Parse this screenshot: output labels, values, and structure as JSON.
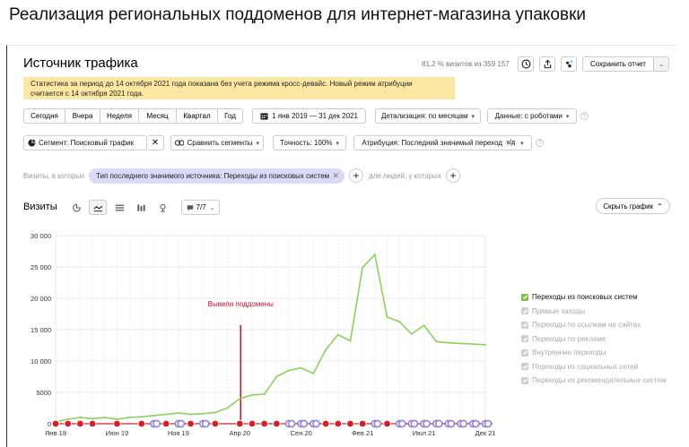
{
  "page_heading": "Реализация региональных поддоменов для интернет-магазина упаковки",
  "report": {
    "title": "Источник трафика",
    "visits_summary": "81,2 % визитов из 359 157",
    "save_label": "Сохранить отчет",
    "notice_line1": "Статистика за период до 14 октября 2021 года показана без учета режима кросс-девайс. Новый режим атрибуции",
    "notice_line2": "считается с 14 октября 2021 года."
  },
  "toolbar": {
    "periods": [
      "Сегодня",
      "Вчера",
      "Неделя",
      "Месяц",
      "Квартал",
      "Год"
    ],
    "date_range": "1 янв 2019 — 31 дек 2021",
    "detail": "Детализация: по месяцам",
    "data": "Данные: с роботами",
    "segment": "Сегмент: Поисковый трафик",
    "compare": "Сравнить сегменты",
    "accuracy": "Точность: 100%",
    "attribution": "Атрибуция: Последний значимый переход",
    "attribution_badge": "к/д"
  },
  "filter": {
    "label": "Визиты, в которых",
    "chip": "Тип последнего значимого источника: Переходы из поисковых систем",
    "people_label": "для людей, у которых"
  },
  "chart_header": {
    "title": "Визиты",
    "sources_count": "7/7",
    "hide_chart": "Скрыть график"
  },
  "colors": {
    "series": "#8fcf5c",
    "annotation": "#c8102e",
    "event_red": "#d0202a",
    "event_purple": "#8f84d6",
    "checkbox_active": "#7bbf4e",
    "checkbox_inactive": "#cfcfcf",
    "notice": "#fce8a2"
  },
  "legend": [
    {
      "label": "Переходы из поисковых систем",
      "active": true
    },
    {
      "label": "Прямые заходы",
      "active": false
    },
    {
      "label": "Переходы по ссылкам на сайтах",
      "active": false
    },
    {
      "label": "Переходы по рекламе",
      "active": false
    },
    {
      "label": "Внутренние переходы",
      "active": false
    },
    {
      "label": "Переходы из социальных сетей",
      "active": false
    },
    {
      "label": "Переходы из рекомендательных систем",
      "active": false
    }
  ],
  "chart_data": {
    "type": "line",
    "title": "",
    "xlabel": "",
    "ylabel": "",
    "x": [
      "2019-01",
      "2019-02",
      "2019-03",
      "2019-04",
      "2019-05",
      "2019-06",
      "2019-07",
      "2019-08",
      "2019-09",
      "2019-10",
      "2019-11",
      "2019-12",
      "2020-01",
      "2020-02",
      "2020-03",
      "2020-04",
      "2020-05",
      "2020-06",
      "2020-07",
      "2020-08",
      "2020-09",
      "2020-10",
      "2020-11",
      "2020-12",
      "2021-01",
      "2021-02",
      "2021-03",
      "2021-04",
      "2021-05",
      "2021-06",
      "2021-07",
      "2021-08",
      "2021-09",
      "2021-10",
      "2021-11",
      "2021-12"
    ],
    "x_tick_labels": [
      "Янв 19",
      "Июн 19",
      "Ноя 19",
      "Апр 20",
      "Сен 20",
      "Фев 21",
      "Июл 21",
      "Дек 21"
    ],
    "x_tick_months": [
      "2019-01",
      "2019-06",
      "2019-11",
      "2020-04",
      "2020-09",
      "2021-02",
      "2021-07",
      "2021-12"
    ],
    "y_ticks": [
      "0",
      "5000",
      "10 000",
      "15 000",
      "20 000",
      "25 000",
      "30 000"
    ],
    "y_tick_values": [
      0,
      5000,
      10000,
      15000,
      20000,
      25000,
      30000
    ],
    "ylim": [
      0,
      30000
    ],
    "grid": true,
    "series": [
      {
        "name": "Переходы из поисковых систем",
        "values": [
          300,
          700,
          1000,
          800,
          1000,
          700,
          1000,
          1100,
          1300,
          1500,
          1700,
          1500,
          1600,
          1800,
          2500,
          4000,
          4600,
          4700,
          7500,
          8500,
          8900,
          8000,
          11800,
          14200,
          13200,
          24900,
          27000,
          17000,
          16300,
          14300,
          15700,
          13100,
          12900,
          12800,
          12700,
          12600
        ]
      }
    ],
    "annotations": [
      {
        "label": "Вывели поддомены",
        "x": "2020-04"
      }
    ],
    "legend_position": "right"
  }
}
